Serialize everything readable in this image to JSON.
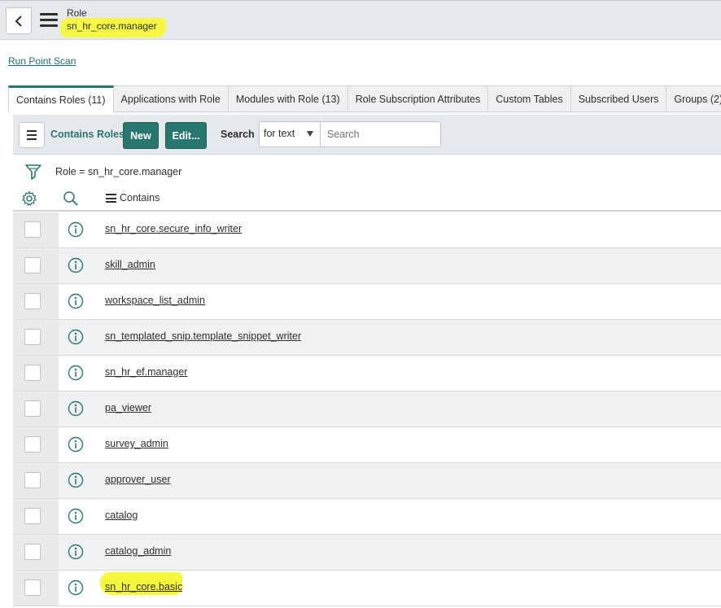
{
  "header": {
    "record_type": "Role",
    "record_name": "sn_hr_core.manager"
  },
  "related": {
    "run_point_scan": "Run Point Scan"
  },
  "tabs": [
    {
      "label": "Contains Roles (11)",
      "active": true
    },
    {
      "label": "Applications with Role"
    },
    {
      "label": "Modules with Role (13)"
    },
    {
      "label": "Role Subscription Attributes"
    },
    {
      "label": "Custom Tables"
    },
    {
      "label": "Subscribed Users"
    },
    {
      "label": "Groups (2)"
    }
  ],
  "toolbar": {
    "list_title": "Contains Roles",
    "new_label": "New",
    "edit_label": "Edit...",
    "search_label": "Search",
    "search_field_value": "for text",
    "search_placeholder": "Search"
  },
  "filter": {
    "text": "Role = sn_hr_core.manager"
  },
  "columns": {
    "contains": "Contains"
  },
  "rows": [
    "sn_hr_core.secure_info_writer",
    "skill_admin",
    "workspace_list_admin",
    "sn_templated_snip.template_snippet_writer",
    "sn_hr_ef.manager",
    "pa_viewer",
    "survey_admin",
    "approver_user",
    "catalog",
    "catalog_admin",
    "sn_hr_core.basic"
  ],
  "colors": {
    "accent": "#28776f",
    "highlight": "#f6f83c",
    "header_bg": "#e6e9eb"
  },
  "icons": {
    "back": "chevron-left-icon",
    "menu": "hamburger-menu-icon",
    "filter": "funnel-icon",
    "settings": "gear-icon",
    "search": "magnifier-icon",
    "info": "info-circle-icon"
  }
}
